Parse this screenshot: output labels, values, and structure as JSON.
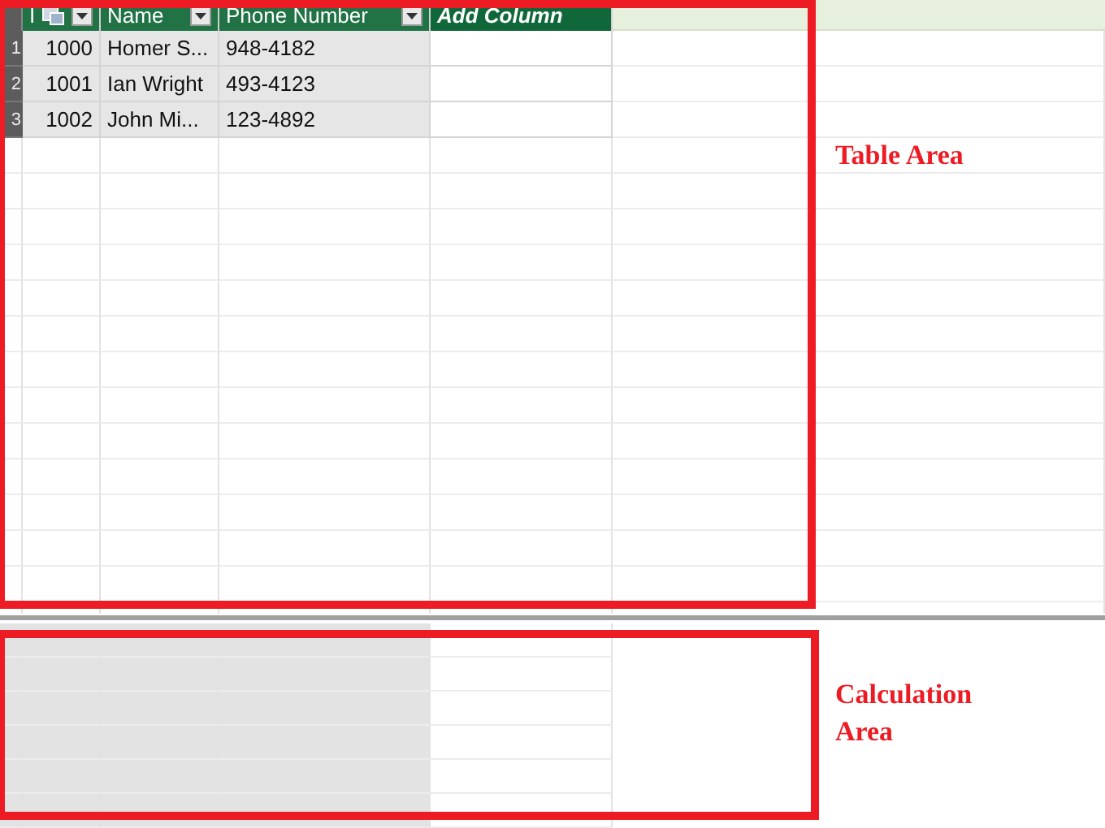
{
  "table": {
    "columns": [
      {
        "label": "I",
        "kind": "key"
      },
      {
        "label": "Name",
        "kind": "data"
      },
      {
        "label": "Phone Number",
        "kind": "data"
      },
      {
        "label": "Add Column",
        "kind": "add"
      }
    ],
    "rows": [
      {
        "number": "1",
        "cells": [
          "1000",
          "Homer S...",
          "948-4182"
        ]
      },
      {
        "number": "2",
        "cells": [
          "1001",
          "Ian Wright",
          "493-4123"
        ]
      },
      {
        "number": "3",
        "cells": [
          "1002",
          "John Mi...",
          "123-4892"
        ]
      }
    ]
  },
  "annotations": [
    {
      "text": "Table Area"
    },
    {
      "text": "Calculation Area"
    }
  ]
}
